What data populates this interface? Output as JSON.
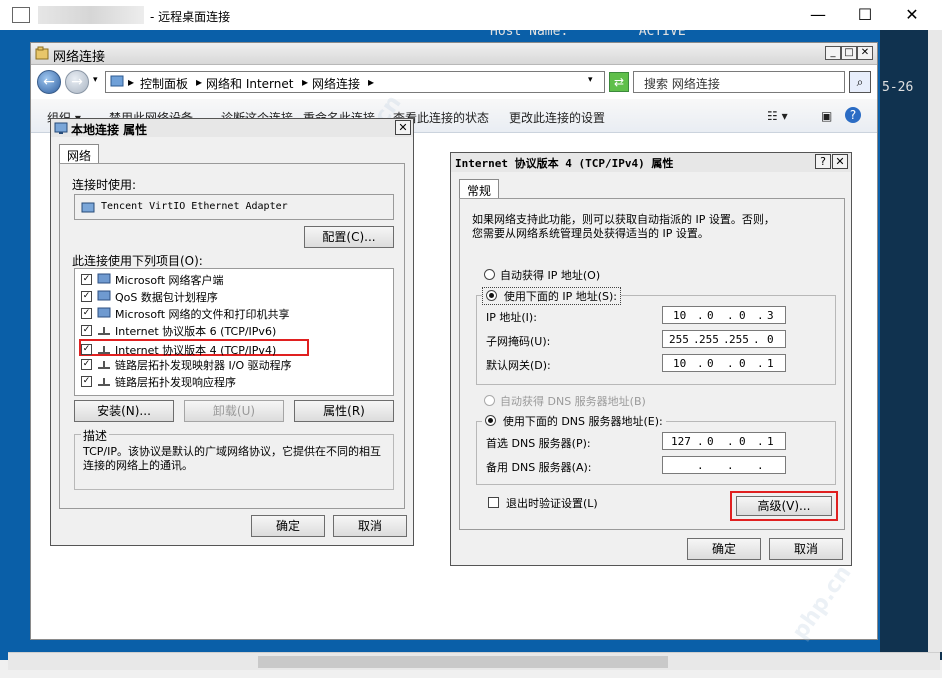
{
  "rdp": {
    "title": "- 远程桌面连接",
    "minimize": "—",
    "maximize": "☐",
    "close": "✕"
  },
  "console": {
    "host_line": "Host Name:         ACTIVE",
    "date_fragment": "5-26"
  },
  "network_window": {
    "title": "网络连接",
    "address_parts": [
      "控制面板",
      "网络和 Internet",
      "网络连接"
    ],
    "search_placeholder": "搜索 网络连接",
    "toolbar_items": [
      "组织 ▾",
      "禁用此网络设备",
      "诊断这个连接",
      "重命名此连接",
      "查看此连接的状态",
      "更改此连接的设置"
    ]
  },
  "local_props": {
    "title": "本地连接 属性",
    "tab": "网络",
    "connect_using_label": "连接时使用:",
    "adapter": "Tencent VirtIO Ethernet Adapter",
    "configure_btn": "配置(C)...",
    "items_label": "此连接使用下列项目(O):",
    "items": [
      {
        "label": "Microsoft 网络客户端",
        "checked": true
      },
      {
        "label": "QoS 数据包计划程序",
        "checked": true
      },
      {
        "label": "Microsoft 网络的文件和打印机共享",
        "checked": true
      },
      {
        "label": "Internet 协议版本 6 (TCP/IPv6)",
        "checked": true
      },
      {
        "label": "Internet 协议版本 4 (TCP/IPv4)",
        "checked": true
      },
      {
        "label": "链路层拓扑发现映射器 I/O 驱动程序",
        "checked": true
      },
      {
        "label": "链路层拓扑发现响应程序",
        "checked": true
      }
    ],
    "install_btn": "安装(N)...",
    "uninstall_btn": "卸载(U)",
    "properties_btn": "属性(R)",
    "description_label": "描述",
    "description": "TCP/IP。该协议是默认的广域网络协议，它提供在不同的相互连接的网络上的通讯。",
    "ok": "确定",
    "cancel": "取消",
    "close": "✕"
  },
  "ipv4": {
    "title": "Internet 协议版本 4 (TCP/IPv4) 属性",
    "help": "?",
    "close": "✕",
    "tab": "常规",
    "intro_line1": "如果网络支持此功能，则可以获取自动指派的 IP 设置。否则，",
    "intro_line2": "您需要从网络系统管理员处获得适当的 IP 设置。",
    "auto_ip": "自动获得 IP 地址(O)",
    "manual_ip": "使用下面的 IP 地址(S):",
    "ip_label": "IP 地址(I):",
    "ip_value": [
      "10",
      "0",
      "0",
      "3"
    ],
    "subnet_label": "子网掩码(U):",
    "subnet_value": [
      "255",
      "255",
      "255",
      "0"
    ],
    "gateway_label": "默认网关(D):",
    "gateway_value": [
      "10",
      "0",
      "0",
      "1"
    ],
    "auto_dns": "自动获得 DNS 服务器地址(B)",
    "manual_dns": "使用下面的 DNS 服务器地址(E):",
    "pref_dns_label": "首选 DNS 服务器(P):",
    "pref_dns_value": [
      "127",
      "0",
      "0",
      "1"
    ],
    "alt_dns_label": "备用 DNS 服务器(A):",
    "alt_dns_value": [
      ".",
      ".",
      "."
    ],
    "validate_label": "退出时验证设置(L)",
    "advanced_btn": "高级(V)...",
    "ok": "确定",
    "cancel": "取消"
  },
  "watermark": "php.cn"
}
